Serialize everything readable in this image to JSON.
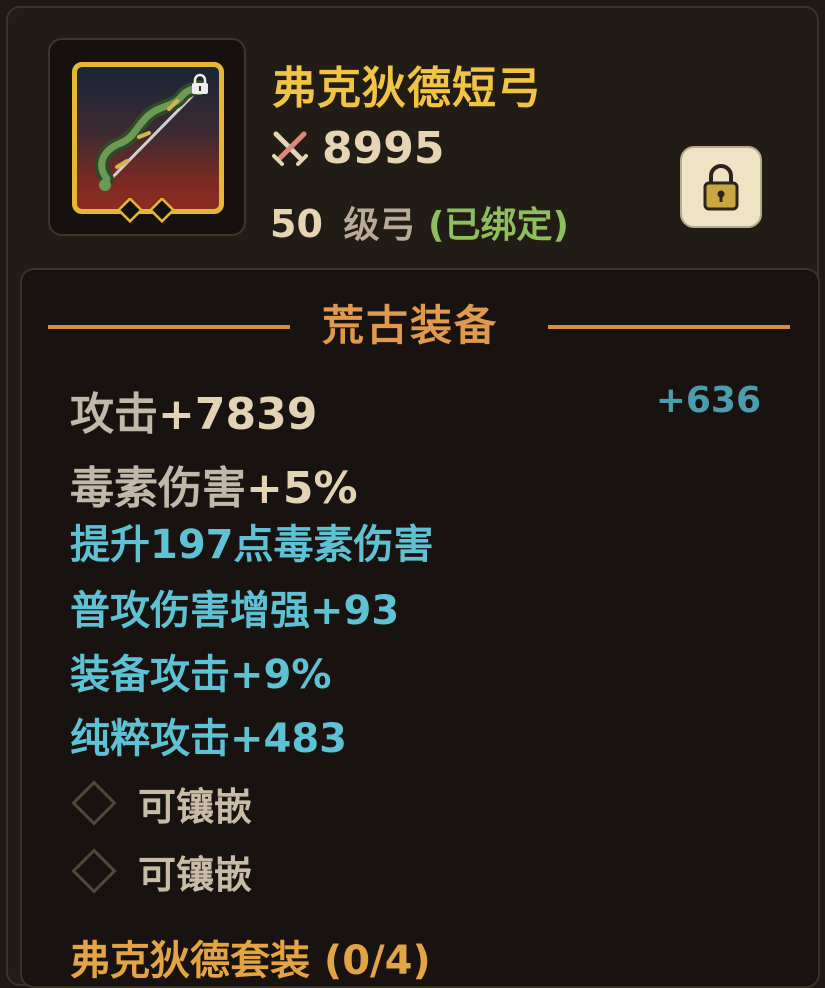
{
  "item": {
    "name": "弗克狄德短弓",
    "power_icon": "crossed-swords-icon",
    "power": "8995",
    "level": "50",
    "level_type": "级弓",
    "bound_status": "(已绑定)",
    "icon_name": "bow-icon",
    "locked": true
  },
  "section": {
    "title": "荒古装备"
  },
  "stats": {
    "attack": {
      "label": "攻击",
      "value": "+7839",
      "bonus": "+636"
    },
    "poison": {
      "label": "毒素伤害",
      "value": "+5%"
    }
  },
  "substats": [
    "提升197点毒素伤害",
    "普攻伤害增强+93",
    "装备攻击+9%",
    "纯粹攻击+483"
  ],
  "sockets": [
    {
      "label": "可镶嵌"
    },
    {
      "label": "可镶嵌"
    }
  ],
  "set": {
    "label": "弗克狄德套装 (0/4)"
  },
  "colors": {
    "title": "#f2c443",
    "section": "#e09a4e",
    "substat": "#5fc2d4",
    "bound": "#8fbf5a",
    "bonus": "#4d9cae"
  }
}
